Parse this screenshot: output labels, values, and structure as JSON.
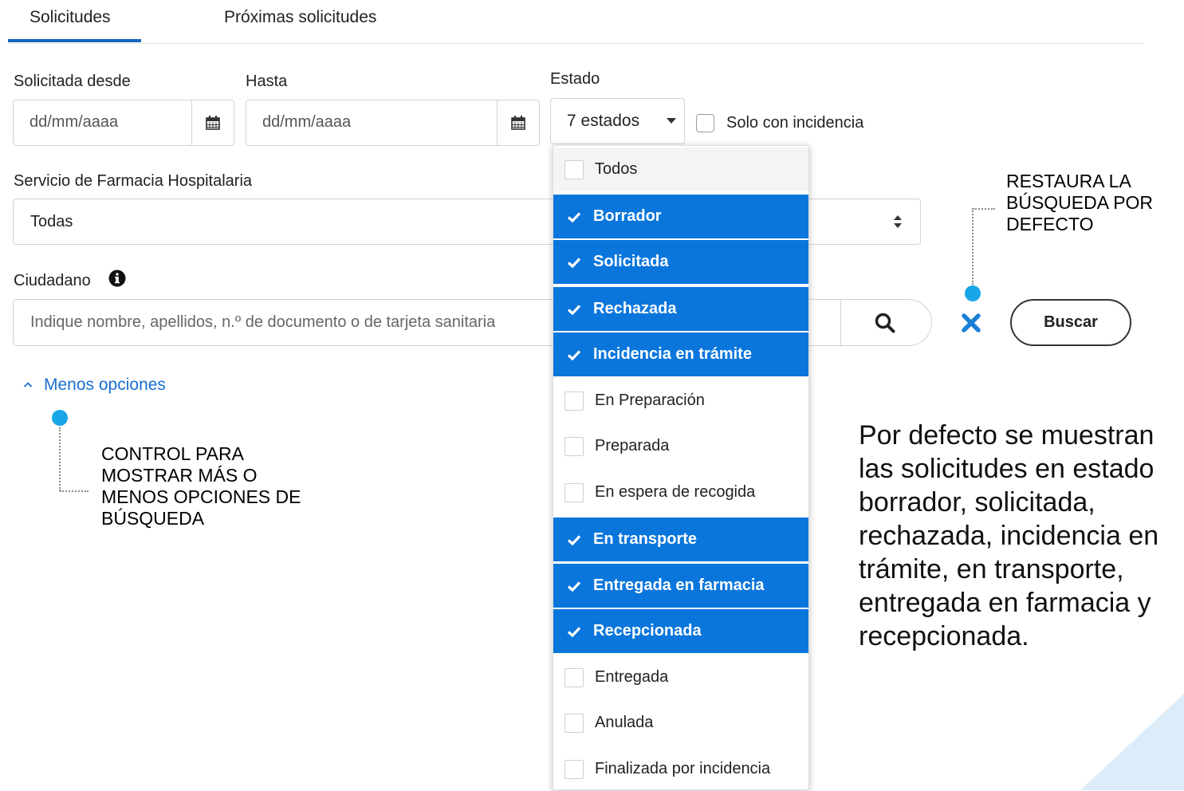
{
  "tabs": [
    {
      "label": "Solicitudes",
      "active": true
    },
    {
      "label": "Próximas solicitudes",
      "active": false
    }
  ],
  "filters": {
    "date_from_label": "Solicitada desde",
    "date_from_placeholder": "dd/mm/aaaa",
    "date_to_label": "Hasta",
    "date_to_placeholder": "dd/mm/aaaa",
    "estado_label": "Estado",
    "estado_value": "7 estados",
    "incidencia_label": "Solo con incidencia",
    "servicio_label": "Servicio de Farmacia Hospitalaria",
    "servicio_value": "Todas",
    "ciudadano_label": "Ciudadano",
    "ciudadano_placeholder": "Indique nombre, apellidos, n.º de documento o de tarjeta sanitaria",
    "buscar_label": "Buscar",
    "less_options_label": "Menos opciones"
  },
  "estado_options": [
    {
      "label": "Todos",
      "selected": false
    },
    {
      "label": "Borrador",
      "selected": true
    },
    {
      "label": "Solicitada",
      "selected": true
    },
    {
      "label": "Rechazada",
      "selected": true
    },
    {
      "label": "Incidencia en trámite",
      "selected": true
    },
    {
      "label": "En Preparación",
      "selected": false
    },
    {
      "label": "Preparada",
      "selected": false
    },
    {
      "label": "En espera de recogida",
      "selected": false
    },
    {
      "label": "En transporte",
      "selected": true
    },
    {
      "label": "Entregada en farmacia",
      "selected": true
    },
    {
      "label": "Recepcionada",
      "selected": true
    },
    {
      "label": "Entregada",
      "selected": false
    },
    {
      "label": "Anulada",
      "selected": false
    },
    {
      "label": "Finalizada por incidencia",
      "selected": false
    }
  ],
  "annotations": {
    "restore": [
      "RESTAURA LA",
      "BÚSQUEDA POR",
      "DEFECTO"
    ],
    "control": [
      "CONTROL PARA",
      "MOSTRAR MÁS O",
      "MENOS OPCIONES DE",
      "BÚSQUEDA"
    ],
    "info": [
      "Por defecto se muestran",
      "las solicitudes en estado",
      "borrador, solicitada,",
      "rechazada, incidencia en",
      "trámite, en transporte,",
      "entregada en farmacia y",
      "recepcionada."
    ]
  },
  "colors": {
    "accent": "#0a76dc",
    "tab_underline": "#1565c0",
    "clear_icon": "#1a7fd6",
    "annotation_dot": "#19a6e8"
  },
  "icons": {
    "calendar": "calendar-icon",
    "dropdown": "chevron-down-icon",
    "info": "info-circle-icon",
    "search": "search-icon",
    "clear": "close-icon",
    "check": "check-icon",
    "sort": "sort-icon",
    "expand": "chevron-up-icon"
  }
}
